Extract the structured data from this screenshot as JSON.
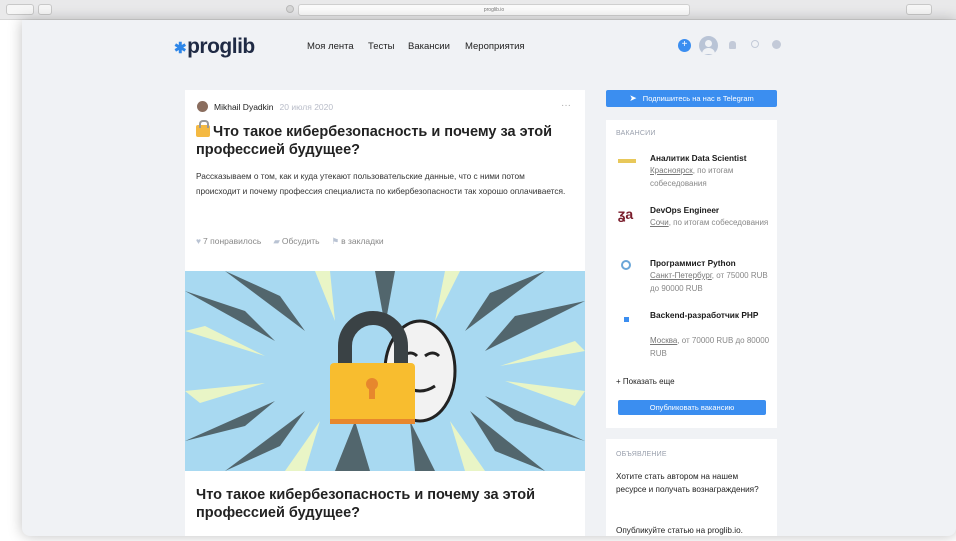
{
  "browser": {
    "url": "proglib.io"
  },
  "header": {
    "logo": "proglib",
    "nav": [
      "Моя лента",
      "Тесты",
      "Вакансии",
      "Мероприятия"
    ],
    "icons": [
      "add-icon",
      "profile-icon",
      "bell-icon",
      "search-icon",
      "theme-icon"
    ],
    "accent": "#2d86e8"
  },
  "article": {
    "author": "Mikhail Dyadkin",
    "date": "20 июля 2020",
    "menu": "···",
    "title": "Что такое кибербезопасность и почему за этой профессией будущее?",
    "excerpt": "Рассказываем о том, как и куда утекают пользовательские данные, что с ними потом происходит и почему профессия специалиста по кибербезопасности так хорошо оплачивается.",
    "likes": "7 понравилось",
    "discuss": "Обсудить",
    "bookmark": "в закладки",
    "title2": "Что такое кибербезопасность и почему за этой профессией будущее?"
  },
  "sidebar": {
    "telegram": "Подпишитесь на нас в Telegram",
    "jobs_heading": "ВАКАНСИИ",
    "jobs": [
      {
        "title": "Аналитик Data Scientist",
        "city": "Красноярск",
        "details": ", по итогам собеседования"
      },
      {
        "title": "DevOps Engineer",
        "city": "Сочи",
        "details": ", по итогам собеседования"
      },
      {
        "title": "Программист Python",
        "city": "Санкт-Петербург",
        "details": ", от 75000 RUB до 90000 RUB"
      },
      {
        "title": "Backend-разработчик PHP",
        "city": "Москва",
        "details": ", от 70000 RUB до 80000 RUB"
      }
    ],
    "show_more": "+ Показать еще",
    "publish": "Опубликовать вакансию",
    "ad_heading": "ОБЪЯВЛЕНИЕ",
    "ad_text": "Хотите стать автором на нашем ресурсе и получать вознаграждения?",
    "ad_text2": "Опубликуйте статью на proglib.io."
  }
}
